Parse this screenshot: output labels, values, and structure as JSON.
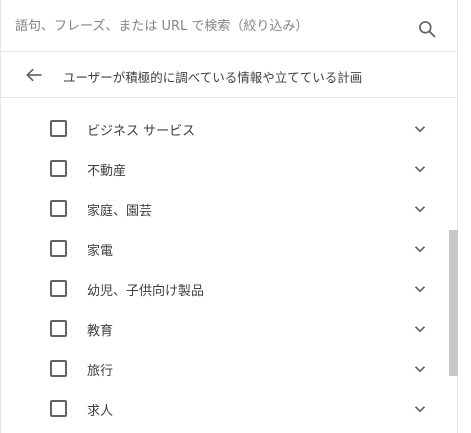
{
  "search": {
    "placeholder": "語句、フレーズ、または URL で検索（絞り込み）",
    "icon": "search-icon"
  },
  "header": {
    "title": "ユーザーが積極的に調べている情報や立てている計画",
    "back_icon": "arrow-left-icon"
  },
  "items": [
    {
      "label": "ビジネス サービス",
      "checked": false
    },
    {
      "label": "不動産",
      "checked": false
    },
    {
      "label": "家庭、園芸",
      "checked": false
    },
    {
      "label": "家電",
      "checked": false
    },
    {
      "label": "幼児、子供向け製品",
      "checked": false
    },
    {
      "label": "教育",
      "checked": false
    },
    {
      "label": "旅行",
      "checked": false
    },
    {
      "label": "求人",
      "checked": false
    }
  ],
  "colors": {
    "text": "#3c4043",
    "icon": "#5f6368",
    "divider": "#e4e4e4",
    "scrollbar": "#c8c8c8"
  }
}
